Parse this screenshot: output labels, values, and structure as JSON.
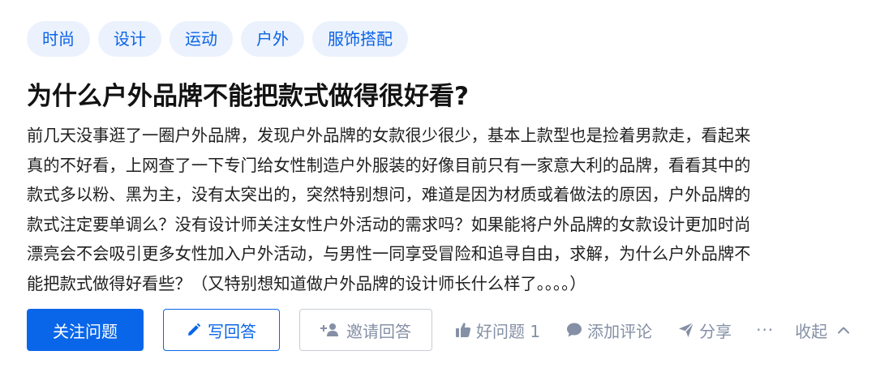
{
  "topics": [
    "时尚",
    "设计",
    "运动",
    "户外",
    "服饰搭配"
  ],
  "question": {
    "title": "为什么户外品牌不能把款式做得很好看?",
    "detail_lines": [
      "前几天没事逛了一圈户外品牌，发现户外品牌的女款很少很少，基本上款型也是捡着男款走，看起来",
      "真的不好看，上网查了一下专门给女性制造户外服装的好像目前只有一家意大利的品牌，看看其中的",
      "款式多以粉、黑为主，没有太突出的，突然特别想问，难道是因为材质或着做法的原因，户外品牌的",
      "款式注定要单调么？没有设计师关注女性户外活动的需求吗？如果能将户外品牌的女款设计更加时尚",
      "漂亮会不会吸引更多女性加入户外活动，与男性一同享受冒险和追寻自由，求解，为什么户外品牌不",
      "能把款式做得好看些？（又特别想知道做户外品牌的设计师长什么样了。。。。）"
    ]
  },
  "actions": {
    "follow_label": "关注问题",
    "answer_label": "写回答",
    "invite_label": "邀请回答",
    "good_question_label": "好问题 1",
    "comment_label": "添加评论",
    "share_label": "分享",
    "more_label": "···",
    "collapse_label": "收起"
  },
  "icons": {
    "answer": "pencil-icon",
    "invite": "add-user-icon",
    "good_question": "thumbs-up-icon",
    "comment": "comment-bubble-icon",
    "share": "paper-plane-icon",
    "collapse": "chevron-up-icon"
  },
  "colors": {
    "accent": "#0a66e9",
    "tag_bg": "#ebf2fd",
    "meta_text": "#8590a6"
  }
}
